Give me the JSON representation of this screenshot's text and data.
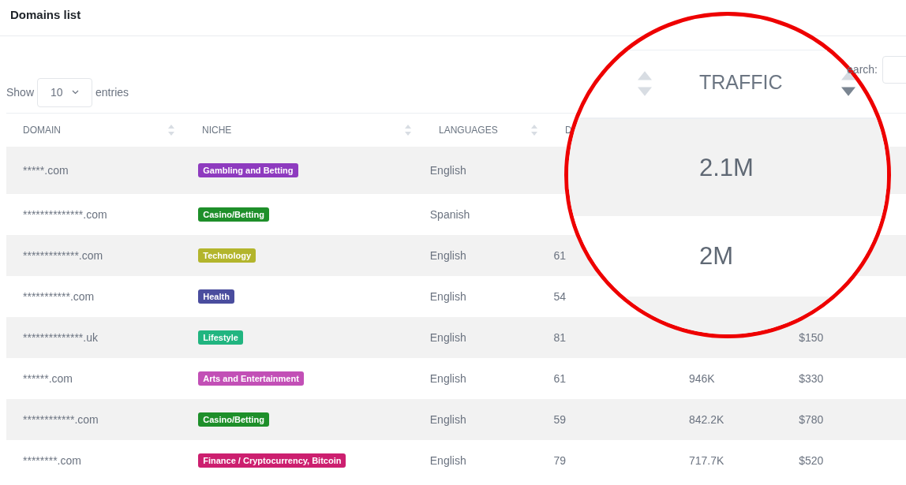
{
  "header": {
    "title": "Domains list"
  },
  "search": {
    "label": "earch:"
  },
  "length": {
    "before": "Show",
    "value": "10",
    "after": "entries"
  },
  "table": {
    "columns": [
      "DOMAIN",
      "NICHE",
      "LANGUAGES",
      "D"
    ],
    "rows": [
      {
        "domain": "*****.com",
        "niche": {
          "label": "Gambling and Betting",
          "color": "#8e3bbf"
        },
        "language": "English"
      },
      {
        "domain": "**************.com",
        "niche": {
          "label": "Casino/Betting",
          "color": "#1e8f2a"
        },
        "language": "Spanish"
      },
      {
        "domain": "*************.com",
        "niche": {
          "label": "Technology",
          "color": "#b3b52c"
        },
        "language": "English",
        "da": "61"
      },
      {
        "domain": "***********.com",
        "niche": {
          "label": "Health",
          "color": "#4a4d9e"
        },
        "language": "English",
        "da": "54"
      },
      {
        "domain": "**************.uk",
        "niche": {
          "label": "Lifestyle",
          "color": "#21b580"
        },
        "language": "English",
        "da": "81",
        "price": "$150"
      },
      {
        "domain": "******.com",
        "niche": {
          "label": "Arts and Entertainment",
          "color": "#c24fb6"
        },
        "language": "English",
        "da": "61",
        "traffic": "946K",
        "price": "$330"
      },
      {
        "domain": "************.com",
        "niche": {
          "label": "Casino/Betting",
          "color": "#1e8f2a"
        },
        "language": "English",
        "da": "59",
        "traffic": "842.2K",
        "price": "$780"
      },
      {
        "domain": "********.com",
        "niche": {
          "label": "Finance / Cryptocurrency, Bitcoin",
          "color": "#cc1f6f"
        },
        "language": "English",
        "da": "79",
        "traffic": "717.7K",
        "price": "$520"
      }
    ]
  },
  "magnifier": {
    "heading": "TRAFFIC",
    "sorted_descending": true,
    "values": [
      "2.1M",
      "2M"
    ]
  }
}
